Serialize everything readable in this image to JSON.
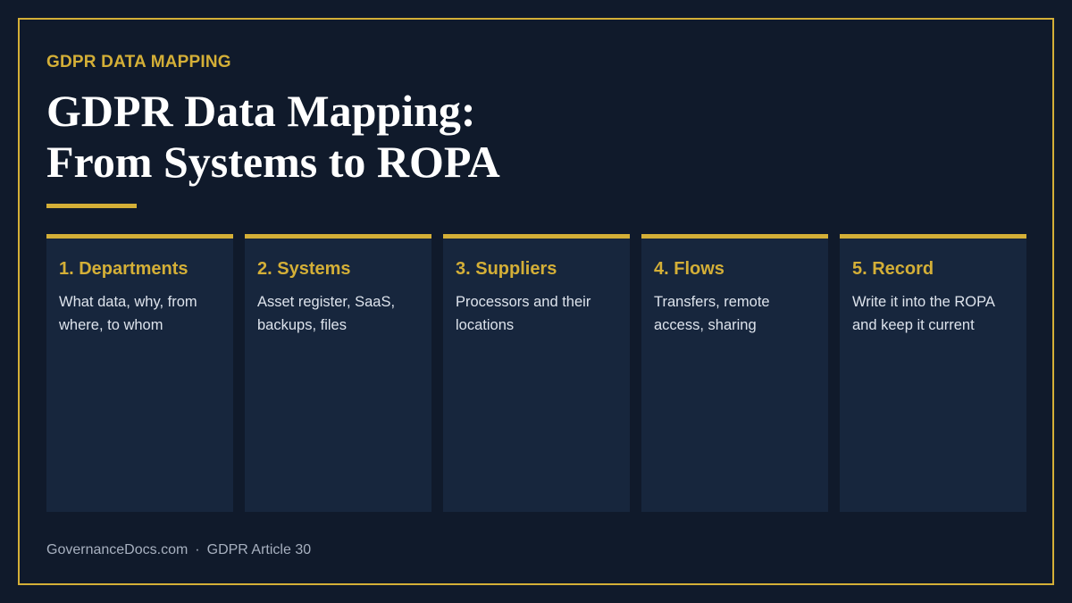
{
  "header": {
    "eyebrow": "GDPR DATA MAPPING",
    "title_line1": "GDPR Data Mapping:",
    "title_line2": "From Systems to ROPA"
  },
  "steps": [
    {
      "title": "1. Departments",
      "body": "What data, why, from where, to whom"
    },
    {
      "title": "2. Systems",
      "body": "Asset register, SaaS, backups, files"
    },
    {
      "title": "3. Suppliers",
      "body": "Processors and their locations"
    },
    {
      "title": "4. Flows",
      "body": "Transfers, remote access, sharing"
    },
    {
      "title": "5. Record",
      "body": "Write it into the ROPA and keep it current"
    }
  ],
  "footer": {
    "site": "GovernanceDocs.com",
    "separator": "·",
    "reference": "GDPR Article 30"
  },
  "colors": {
    "background": "#101a2b",
    "card": "#17263d",
    "accent": "#d4af37",
    "text": "#ffffff",
    "muted": "#a7b0bf"
  }
}
